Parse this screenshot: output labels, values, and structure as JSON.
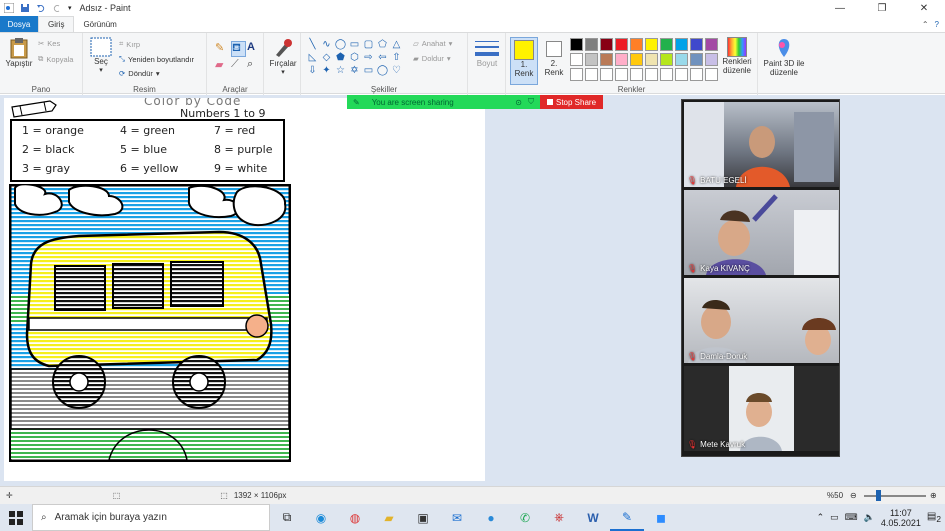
{
  "window": {
    "title": "Adsız - Paint"
  },
  "menu": {
    "file": "Dosya",
    "tabs": [
      "Giriş",
      "Görünüm"
    ]
  },
  "ribbon": {
    "pano": {
      "label": "Pano",
      "paste": "Yapıştır",
      "cut": "Kes",
      "copy": "Kopyala"
    },
    "resim": {
      "label": "Resim",
      "select": "Seç",
      "crop": "Kırp",
      "resize": "Yeniden boyutlandır",
      "rotate": "Döndür"
    },
    "araclar": {
      "label": "Araçlar"
    },
    "brushes": {
      "label": "Fırçalar"
    },
    "sekiller": {
      "label": "Şekiller",
      "outline": "Anahat",
      "fill": "Doldur"
    },
    "size": {
      "label": "Boyut"
    },
    "renkler": {
      "label": "Renkler",
      "color1": "1. Renk",
      "color2": "2. Renk",
      "edit": "Renkleri düzenle",
      "paint3d": "Paint 3D ile düzenle",
      "palette_top": [
        "#000000",
        "#7f7f7f",
        "#880015",
        "#ed1c24",
        "#ff7f27",
        "#fff200",
        "#22b14c",
        "#00a2e8",
        "#3f48cc",
        "#a349a4"
      ],
      "palette_mid": [
        "#ffffff",
        "#c3c3c3",
        "#b97a57",
        "#ffaec9",
        "#ffc90e",
        "#efe4b0",
        "#b5e61d",
        "#99d9ea",
        "#7092be",
        "#c8bfe7"
      ]
    }
  },
  "share": {
    "status": "You are screen sharing",
    "stop": "Stop Share"
  },
  "worksheet": {
    "title": "Color by Code",
    "subtitle": "Numbers 1 to 9",
    "key": [
      [
        "1 = orange",
        "4 = green",
        "7 = red"
      ],
      [
        "2 = black",
        "5 = blue",
        "8 = purple"
      ],
      [
        "3 = gray",
        "6 = yellow",
        "9 = white"
      ]
    ]
  },
  "participants": [
    {
      "name": "BATU EGELİ"
    },
    {
      "name": "Kaya KIVANÇ"
    },
    {
      "name": "Damla-Doruk"
    },
    {
      "name": "Mete Kavruk"
    }
  ],
  "status": {
    "dimensions": "1392 × 1106px",
    "zoom": "%50"
  },
  "taskbar": {
    "search": "Aramak için buraya yazın",
    "time": "11:07",
    "date": "4.05.2021",
    "notif": "2"
  }
}
